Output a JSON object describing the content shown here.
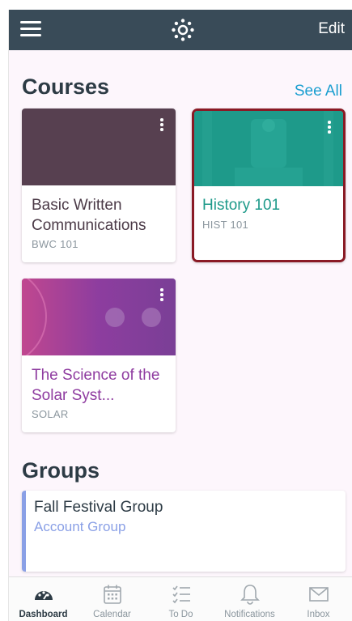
{
  "topbar": {
    "edit_label": "Edit"
  },
  "courses": {
    "title": "Courses",
    "see_all_label": "See All",
    "items": [
      {
        "name": "Basic Written Communications",
        "code": "BWC 101",
        "color": "#574050"
      },
      {
        "name": "History 101",
        "code": "HIST 101",
        "color": "#1e9a8a"
      },
      {
        "name": "The Science of the Solar Syst...",
        "code": "SOLAR",
        "color": "#8f3ca0"
      }
    ]
  },
  "groups": {
    "title": "Groups",
    "items": [
      {
        "name": "Fall Festival Group",
        "type": "Account Group",
        "color": "#8aa0e6"
      }
    ]
  },
  "tabbar": {
    "tabs": [
      {
        "label": "Dashboard",
        "icon": "dashboard-icon",
        "active": true
      },
      {
        "label": "Calendar",
        "icon": "calendar-icon"
      },
      {
        "label": "To Do",
        "icon": "todo-icon"
      },
      {
        "label": "Notifications",
        "icon": "bell-icon"
      },
      {
        "label": "Inbox",
        "icon": "inbox-icon"
      }
    ]
  }
}
